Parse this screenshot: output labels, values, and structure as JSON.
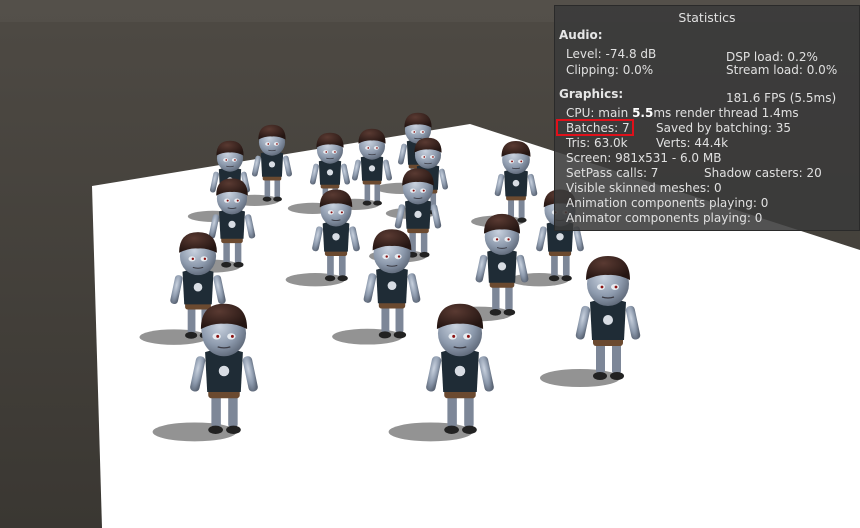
{
  "stats": {
    "title": "Statistics",
    "audio": {
      "header": "Audio:",
      "level": "Level: -74.8 dB",
      "clipping": "Clipping: 0.0%",
      "dsp_load": "DSP load: 0.2%",
      "stream_load": "Stream load: 0.0%"
    },
    "graphics": {
      "header": "Graphics:",
      "fps": "181.6 FPS (5.5ms)",
      "cpu_prefix": "CPU: main ",
      "cpu_main": "5.5",
      "cpu_suffix": "ms  render thread 1.4ms",
      "batches": "Batches: 7",
      "saved_by_batching": "Saved by batching: 35",
      "tris": "Tris: 63.0k",
      "verts": "Verts: 44.4k",
      "screen": "Screen: 981x531 - 6.0 MB",
      "setpass": "SetPass calls: 7",
      "shadow_casters": "Shadow casters: 20",
      "visible_skinned": "Visible skinned meshes: 0",
      "animation_playing": "Animation components playing: 0",
      "animator_playing": "Animator components playing: 0"
    }
  },
  "highlight_color": "#e0101a"
}
